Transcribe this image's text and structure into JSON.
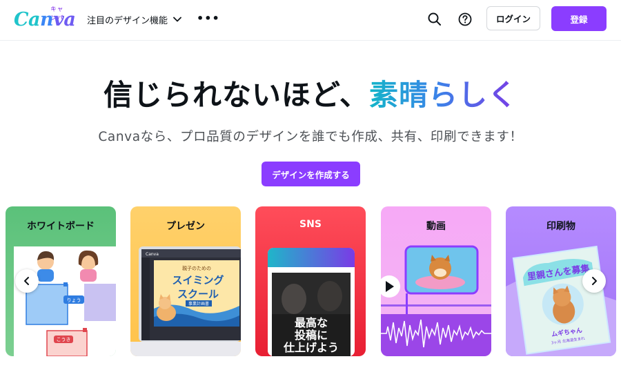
{
  "logo": {
    "kana": "キャンバ",
    "c1": "Ca",
    "c2": "n",
    "c3": "va"
  },
  "nav": {
    "features_label": "注目のデザイン機能",
    "more_label": "•••"
  },
  "header": {
    "login_label": "ログイン",
    "signup_label": "登録"
  },
  "hero": {
    "title_main": "信じられないほど、",
    "title_accent": "素晴らしく",
    "subtitle": "Canvaなら、プロ品質のデザインを誰でも作成、共有、印刷できます！",
    "cta_label": "デザインを作成する"
  },
  "cards": [
    {
      "title": "ホワイトボード",
      "notes": [
        "りょう",
        "こうき"
      ]
    },
    {
      "title": "プレゼン",
      "app_label": "Canva",
      "slide_small": "親子のための",
      "slide_line1": "スイミング",
      "slide_line2": "スクール",
      "slide_tag": "事業計画書"
    },
    {
      "title": "SNS",
      "post_text": [
        "最高な",
        "投稿に",
        "仕上げよう"
      ]
    },
    {
      "title": "動画"
    },
    {
      "title": "印刷物",
      "poster_title": "里親さんを募集",
      "pet_name": "ムギちゃん",
      "pet_info": "3ヶ月 北海道生まれ"
    }
  ],
  "colors": {
    "primary": "#8b3dff",
    "text": "#0e1318",
    "muted": "#4d5156"
  },
  "icons": [
    "search-icon",
    "help-icon",
    "chevron-down-icon",
    "chevron-left-icon",
    "chevron-right-icon",
    "play-icon"
  ]
}
